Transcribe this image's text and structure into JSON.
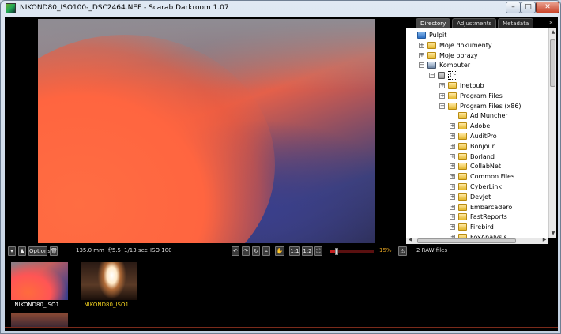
{
  "window": {
    "title": "NIKOND80_ISO100-_DSC2464.NEF - Scarab Darkroom 1.07",
    "controls": {
      "minimize": "–",
      "maximize": "□",
      "close": "✕"
    }
  },
  "panel": {
    "tabs": [
      "Directory",
      "Adjustments",
      "Metadata"
    ],
    "active_tab": "Directory",
    "close_glyph": "×",
    "tree": [
      {
        "label": "Pulpit",
        "icon": "desktop-icon",
        "level": 0,
        "expander": ""
      },
      {
        "label": "Moje dokumenty",
        "icon": "folder-icon",
        "level": 1,
        "expander": "+"
      },
      {
        "label": "Moje obrazy",
        "icon": "folder-icon",
        "level": 1,
        "expander": "+"
      },
      {
        "label": "Komputer",
        "icon": "computer-icon",
        "level": 1,
        "expander": "−"
      },
      {
        "label": "C:",
        "icon": "drive-icon",
        "level": 2,
        "expander": "−",
        "selected": true
      },
      {
        "label": "inetpub",
        "icon": "folder-icon",
        "level": 3,
        "expander": "+"
      },
      {
        "label": "Program Files",
        "icon": "folder-icon",
        "level": 3,
        "expander": "+"
      },
      {
        "label": "Program Files (x86)",
        "icon": "folder-icon",
        "level": 3,
        "expander": "−"
      },
      {
        "label": "Ad Muncher",
        "icon": "folder-icon",
        "level": 4,
        "expander": ""
      },
      {
        "label": "Adobe",
        "icon": "folder-icon",
        "level": 4,
        "expander": "+"
      },
      {
        "label": "AuditPro",
        "icon": "folder-icon",
        "level": 4,
        "expander": "+"
      },
      {
        "label": "Bonjour",
        "icon": "folder-icon",
        "level": 4,
        "expander": "+"
      },
      {
        "label": "Borland",
        "icon": "folder-icon",
        "level": 4,
        "expander": "+"
      },
      {
        "label": "CollabNet",
        "icon": "folder-icon",
        "level": 4,
        "expander": "+"
      },
      {
        "label": "Common Files",
        "icon": "folder-icon",
        "level": 4,
        "expander": "+"
      },
      {
        "label": "CyberLink",
        "icon": "folder-icon",
        "level": 4,
        "expander": "+"
      },
      {
        "label": "DevJet",
        "icon": "folder-icon",
        "level": 4,
        "expander": "+"
      },
      {
        "label": "Embarcadero",
        "icon": "folder-icon",
        "level": 4,
        "expander": "+"
      },
      {
        "label": "FastReports",
        "icon": "folder-icon",
        "level": 4,
        "expander": "+"
      },
      {
        "label": "Firebird",
        "icon": "folder-icon",
        "level": 4,
        "expander": "+"
      },
      {
        "label": "FoxAnalysis",
        "icon": "folder-icon",
        "level": 4,
        "expander": "+"
      }
    ]
  },
  "toolbar": {
    "options_label": "Options",
    "focal_length": "135.0 mm",
    "aperture": "f/5.5",
    "shutter": "1/13 sec",
    "iso": "ISO 100",
    "zoom_11_label": "1:1",
    "zoom_12_label": "1:2",
    "zoom_percent": "15%",
    "zoom_level": 0.15,
    "raw_count": "2 RAW files"
  },
  "filmstrip": {
    "items": [
      {
        "caption": "NIKOND80_ISO1...",
        "color": "#ffffff"
      },
      {
        "caption": "NIKOND80_ISO1...",
        "color": "#f0d020"
      }
    ]
  },
  "colors": {
    "accent_zoom": "#e0a020",
    "selected_caption": "#f0d020",
    "slider": "#c52020"
  }
}
